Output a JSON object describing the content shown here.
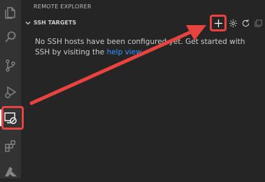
{
  "sidebar": {
    "title": "REMOTE EXPLORER",
    "section": {
      "title": "SSH TARGETS",
      "actions": [
        {
          "name": "add-new-ssh-host",
          "icon": "plus-icon"
        },
        {
          "name": "configure",
          "icon": "gear-icon"
        },
        {
          "name": "refresh",
          "icon": "refresh-icon"
        },
        {
          "name": "collapse-all",
          "icon": "collapse-all-icon"
        }
      ]
    },
    "empty_message": {
      "prefix": "No SSH hosts have been configured yet. Get started with SSH by visiting the ",
      "link": "help view",
      "suffix": "."
    }
  },
  "activity_bar": {
    "items": [
      {
        "name": "explorer",
        "icon": "files-icon"
      },
      {
        "name": "search",
        "icon": "search-icon"
      },
      {
        "name": "source-control",
        "icon": "source-control-icon"
      },
      {
        "name": "run-debug",
        "icon": "debug-icon"
      },
      {
        "name": "remote-explorer",
        "icon": "remote-explorer-icon",
        "active": true
      },
      {
        "name": "extensions",
        "icon": "extensions-icon"
      },
      {
        "name": "azure",
        "icon": "azure-icon"
      }
    ]
  },
  "colors": {
    "background": "#252526",
    "activity_bar": "#333333",
    "link": "#3794ff",
    "annotation": "#e8433f"
  }
}
